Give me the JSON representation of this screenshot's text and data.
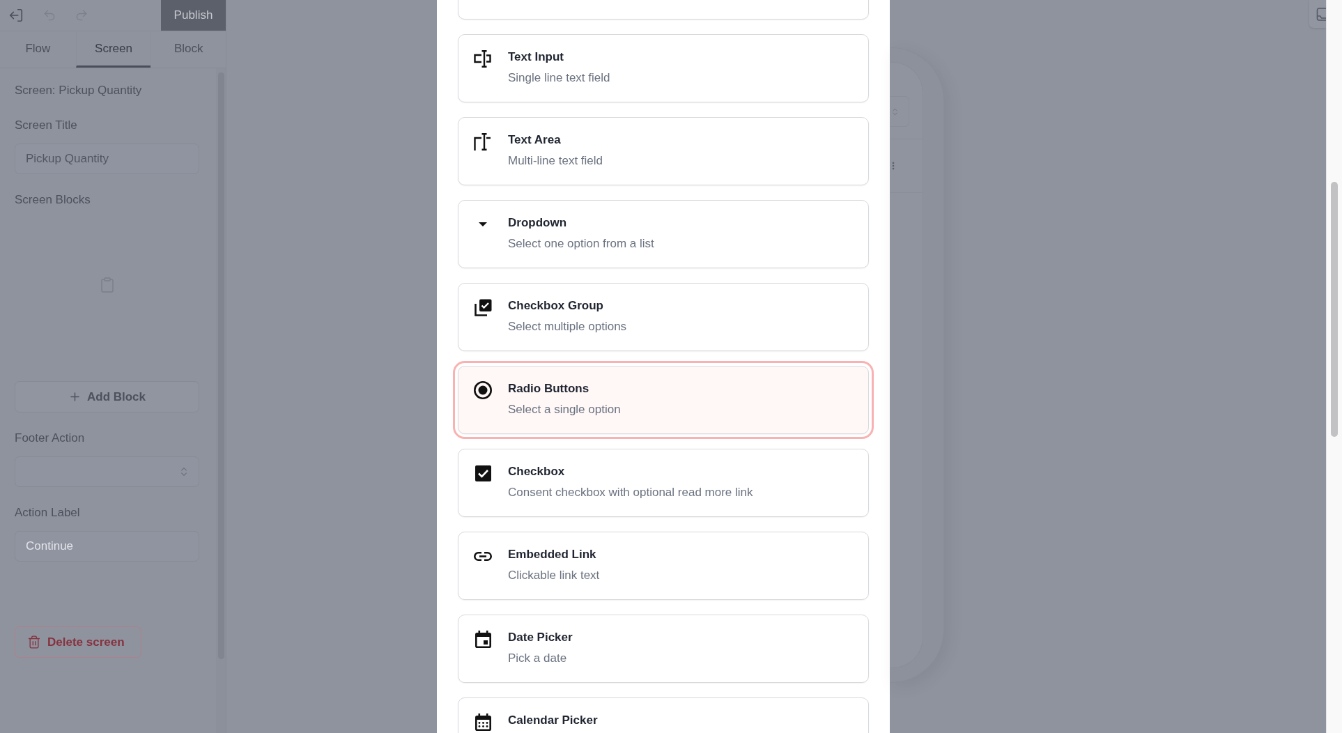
{
  "toolbar": {
    "undo": {
      "disabled": true
    },
    "redo": {
      "disabled": true
    },
    "publish_button": "Publish"
  },
  "tabs": [
    {
      "label": "Flow",
      "selected": false
    },
    {
      "label": "Screen",
      "selected": true
    },
    {
      "label": "Block",
      "selected": false
    }
  ],
  "sidebar": {
    "heading": "Screen: Pickup Quantity",
    "screen_title": {
      "label": "Screen Title",
      "value": "Pickup Quantity"
    },
    "screen_blocks": {
      "label": "Screen Blocks",
      "add_button": "Add Block"
    },
    "footer_action": {
      "label": "Footer Action"
    },
    "action_label": {
      "label": "Action Label",
      "placeholder": "Continue"
    },
    "delete_button": "Delete screen"
  },
  "block_picker": {
    "options": [
      {
        "selected": false
      },
      {
        "kind": "text_input",
        "title": "Text Input",
        "description": "Single line text field",
        "selected": false
      },
      {
        "kind": "text_area",
        "title": "Text Area",
        "description": "Multi-line text field",
        "selected": false
      },
      {
        "kind": "dropdown",
        "title": "Dropdown",
        "description": "Select one option from a list",
        "selected": false
      },
      {
        "kind": "checkbox_group",
        "title": "Checkbox Group",
        "description": "Select multiple options",
        "selected": false
      },
      {
        "kind": "radio",
        "title": "Radio Buttons",
        "description": "Select a single option",
        "selected": true
      },
      {
        "kind": "checkbox",
        "title": "Checkbox",
        "description": "Consent checkbox with optional read more link",
        "selected": false
      },
      {
        "kind": "link",
        "title": "Embedded Link",
        "description": "Clickable link text",
        "selected": false
      },
      {
        "kind": "date",
        "title": "Date Picker",
        "description": "Pick a date",
        "selected": false
      },
      {
        "kind": "calendar",
        "title": "Calendar Picker",
        "selected": false
      }
    ]
  }
}
